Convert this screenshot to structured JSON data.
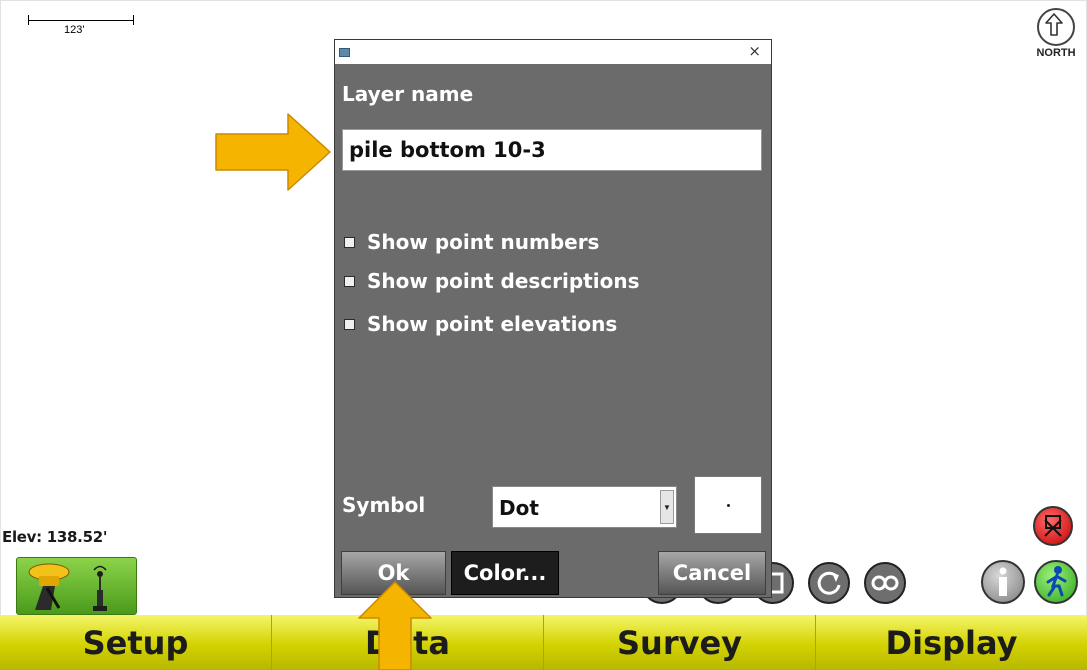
{
  "map": {
    "scale_label": "123'",
    "north_label": "NORTH",
    "elevation": "Elev: 138.52'"
  },
  "dialog": {
    "close_symbol": "×",
    "layer_name_label": "Layer name",
    "layer_name_value": "pile bottom 10-3",
    "checkboxes": [
      {
        "label": "Show point numbers",
        "checked": true
      },
      {
        "label": "Show point descriptions",
        "checked": true
      },
      {
        "label": "Show point elevations",
        "checked": true
      }
    ],
    "symbol_label": "Symbol",
    "symbol_value": "Dot",
    "buttons": {
      "ok": "Ok",
      "color": "Color...",
      "cancel": "Cancel"
    }
  },
  "menu": {
    "tabs": [
      "Setup",
      "Data",
      "Survey",
      "Display"
    ]
  },
  "icons": {
    "north": "north-arrow-icon",
    "receiver": "gps-receiver-icon",
    "record": "stop-record-icon",
    "info": "info-icon",
    "walk": "walking-person-icon",
    "callout_arrow": "callout-arrow-icon"
  },
  "colors": {
    "menu_yellow": "#d2d200",
    "dialog_gray": "#6b6b6b",
    "arrow_orange": "#f5b400",
    "receiver_green": "#5eb42a"
  }
}
